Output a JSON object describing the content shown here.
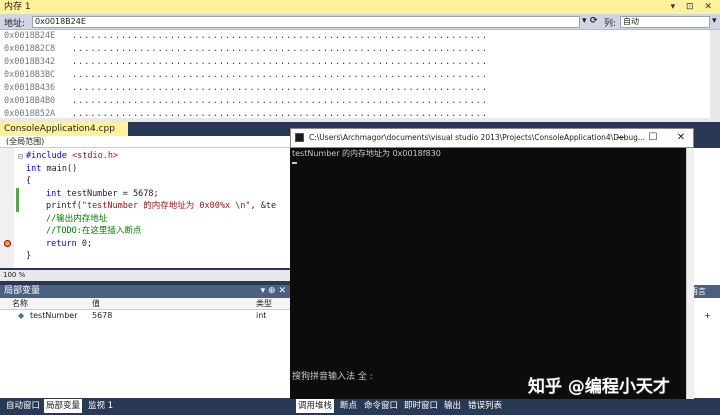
{
  "memory": {
    "title": "内存 1",
    "title_buttons": "▾ ⊡ ✕",
    "addr_label": "地址:",
    "addr_value": "0x0018B24E",
    "col_label": "列:",
    "col_value": "自动",
    "rows": [
      {
        "addr": "0x0018B24E",
        "dots": "...................................................................."
      },
      {
        "addr": "0x0018B2C8",
        "dots": "...................................................................."
      },
      {
        "addr": "0x0018B342",
        "dots": "...................................................................."
      },
      {
        "addr": "0x0018B3BC",
        "dots": "...................................................................."
      },
      {
        "addr": "0x0018B436",
        "dots": "...................................................................."
      },
      {
        "addr": "0x0018B4B0",
        "dots": "...................................................................."
      },
      {
        "addr": "0x0018B52A",
        "dots": "...................................................................."
      }
    ]
  },
  "editor": {
    "tab_label": "ConsoleApplication4.cpp",
    "tab_pin": "⊕",
    "tab_close": "✕",
    "scope": "(全局范围)",
    "zoom": "100 %",
    "lines": {
      "l1_a": "#include ",
      "l1_b": "<stdio.h>",
      "l2_a": "int",
      "l2_b": " main()",
      "l3": "{",
      "l4_a": "int",
      "l4_b": " testNumber = 5678;",
      "l5_a": "printf(",
      "l5_b": "\"testNumber 的内存地址为 0x00%x \\n\"",
      "l5_c": ", &te",
      "l6": "//输出内存地址",
      "l7": "//TODO:在这里插入断点",
      "l8_a": "return",
      "l8_b": " 0;",
      "l9": "}"
    }
  },
  "locals": {
    "title": "局部变量",
    "buttons": "▾ ⊕ ✕",
    "col_name": "名称",
    "col_value": "值",
    "col_type": "类型",
    "row": {
      "name": "testNumber",
      "value": "5678",
      "type": "int"
    }
  },
  "right_panel": {
    "title": "语言",
    "row1": "+"
  },
  "console": {
    "title": "C:\\Users\\Archmagor\\documents\\visual studio 2013\\Projects\\ConsoleApplication4\\Debug...",
    "min": "—",
    "max": "☐",
    "close": "✕",
    "output": "testNumber 的内存地址为 0x0018f830",
    "ime": "搜狗拼音输入法 全 :"
  },
  "bottom_tabs_left": [
    "自动窗口",
    "局部变量",
    "监视 1"
  ],
  "bottom_tabs_right": [
    "调用堆栈",
    "断点",
    "命令窗口",
    "即时窗口",
    "输出",
    "错误列表"
  ],
  "watermark": "知乎 @编程小天才"
}
